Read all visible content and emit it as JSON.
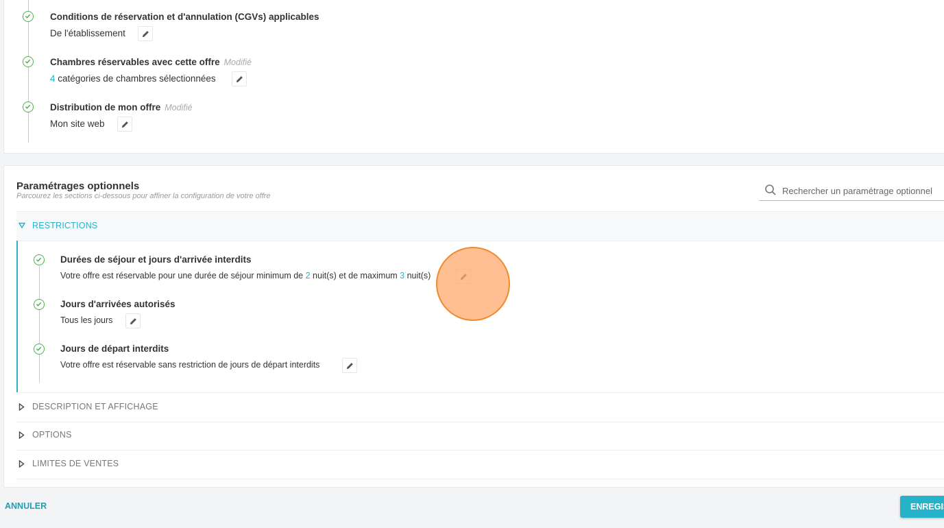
{
  "top_steps": [
    {
      "title": "Conditions de réservation et d'annulation (CGVs) applicables",
      "modified": "",
      "value": "De l'établissement"
    },
    {
      "title": "Chambres réservables avec cette offre",
      "modified": "Modifié",
      "value_num": "4",
      "value_rest": " catégories de chambres sélectionnées"
    },
    {
      "title": "Distribution de mon offre",
      "modified": "Modifié",
      "value": "Mon site web"
    }
  ],
  "optional": {
    "title": "Paramétrages optionnels",
    "subtitle": "Parcourez les sections ci-dessous pour affiner la configuration de votre offre",
    "search_placeholder": "Rechercher un paramétrage optionnel"
  },
  "sections": {
    "restrictions": "RESTRICTIONS",
    "description": "DESCRIPTION ET AFFICHAGE",
    "options": "OPTIONS",
    "limits": "LIMITES DE VENTES"
  },
  "restriction_items": [
    {
      "title": "Durées de séjour et jours d'arrivée interdits",
      "v1": "Votre offre est réservable pour une durée de séjour minimum de ",
      "min": "2",
      "v2": " nuit(s) et de maximum ",
      "max": "3",
      "v3": " nuit(s)"
    },
    {
      "title": "Jours d'arrivées autorisés",
      "value": "Tous les jours"
    },
    {
      "title": "Jours de départ interdits",
      "value": "Votre offre est réservable sans restriction de jours de départ interdits"
    }
  ],
  "footer": {
    "cancel": "ANNULER",
    "save": "ENREGISTRER"
  },
  "icons": {
    "check": "check-circle-icon",
    "edit": "pencil-icon",
    "search": "search-icon",
    "expand": "triangle-down-icon",
    "collapse": "triangle-right-icon"
  },
  "colors": {
    "accent": "#26b3c9",
    "success": "#4caf50"
  }
}
